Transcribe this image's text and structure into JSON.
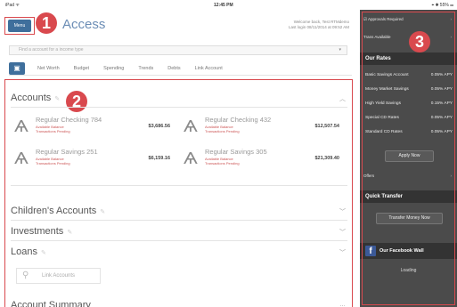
{
  "status_bar": {
    "left": "iPad ᯤ",
    "time": "12:45 PM",
    "right": "⌖ ✱ 55% ▭"
  },
  "header": {
    "menu_label": "Menu",
    "brand": "Access",
    "welcome_line1": "Welcome back, Test RTMdemo",
    "welcome_line2": "Last login 08/11/2014 at 09:52 AM"
  },
  "callouts": [
    "1",
    "2",
    "3"
  ],
  "search": {
    "placeholder": "Find a account for a income type",
    "chevron": "▾"
  },
  "tabs": [
    "Net Worth",
    "Budget",
    "Spending",
    "Trends",
    "Debts",
    "Link Account"
  ],
  "sections": {
    "accounts": "Accounts",
    "children": "Children's Accounts",
    "investments": "Investments",
    "loans": "Loans",
    "summary": "Account Summary"
  },
  "accounts": [
    {
      "name": "Regular Checking 784",
      "line1": "Available Balance",
      "line2": "Transactions Pending",
      "amount": "$3,686.56"
    },
    {
      "name": "Regular Checking 432",
      "line1": "Available Balance",
      "line2": "Transactions Pending",
      "amount": "$12,507.54"
    },
    {
      "name": "Regular Savings 251",
      "line1": "Available Balance",
      "line2": "Transactions Pending",
      "amount": "$6,159.16"
    },
    {
      "name": "Regular Savings 305",
      "line1": "Available Balance",
      "line2": "Transactions Pending",
      "amount": "$21,309.40"
    }
  ],
  "link_accounts": "Link Accounts",
  "right_panel": {
    "approvals": "Approvals Required",
    "transactions": "Trans Available",
    "our_rates": "Our Rates",
    "rates": [
      {
        "label": "Basic Savings Account",
        "value": "0.05% APY"
      },
      {
        "label": "Money Market Savings",
        "value": "0.05% APY"
      },
      {
        "label": "High Yield Savings",
        "value": "0.15% APY"
      },
      {
        "label": "Special CD Rates",
        "value": "0.05% APY"
      },
      {
        "label": "Standard CD Rates",
        "value": "0.05% APY"
      }
    ],
    "apply_now": "Apply Now",
    "offers": "Offers",
    "quick_transfer": "Quick Transfer",
    "transfer_btn": "Transfer Money Now",
    "facebook": "Our Facebook Wall",
    "loading": "Loading"
  },
  "colors": {
    "accent": "#3f6f9c",
    "highlight": "#d9494e",
    "panel": "#4b4b4b",
    "facebook": "#3b5998"
  }
}
